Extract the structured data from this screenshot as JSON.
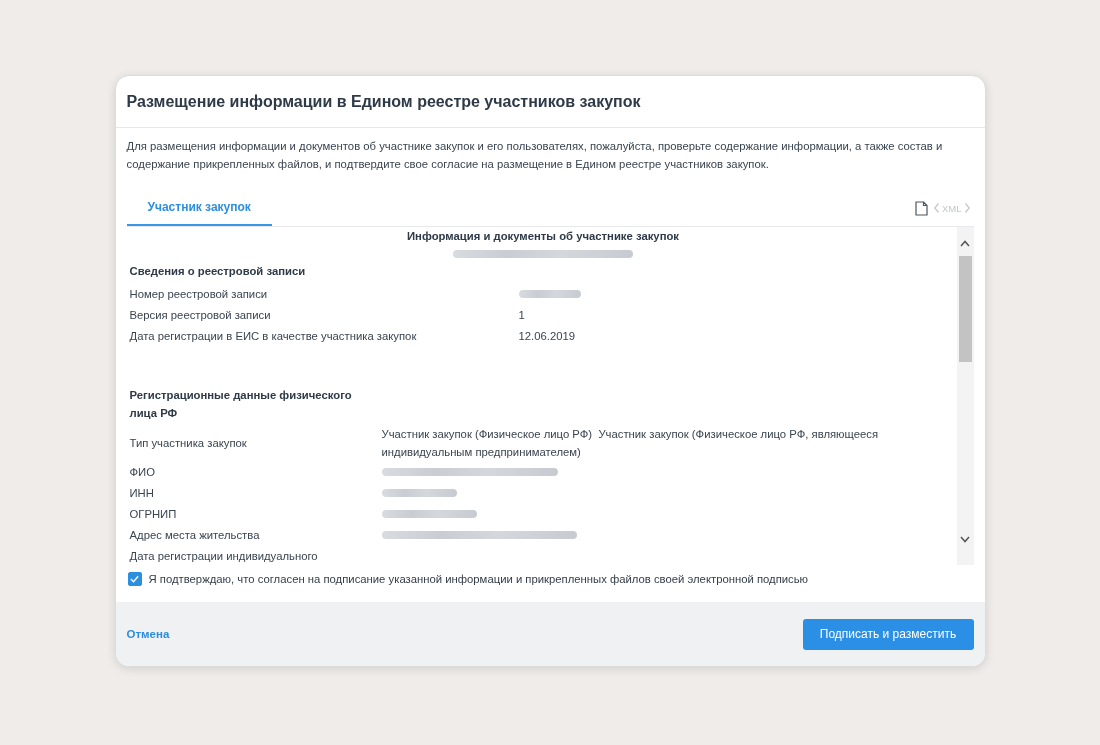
{
  "dialog": {
    "title": "Размещение информации в Едином реестре участников закупок"
  },
  "description": "Для размещения информации и документов об участнике закупок и его пользователях, пожалуйста, проверьте содержание информации, а также состав и содержание прикрепленных файлов, и подтвердите свое согласие на размещение в Едином реестре участников закупок.",
  "tabs": [
    {
      "label": "Участник закупок",
      "selected": true
    }
  ],
  "xml_link": {
    "label": "XML",
    "disabled": true
  },
  "document": {
    "heading": "Информация и документы об участнике закупок",
    "subheading_redacted": true,
    "sections": [
      {
        "title": "Сведения о реестровой записи",
        "rows": [
          {
            "label": "Номер реестровой записи",
            "redacted": true
          },
          {
            "label": "Версия реестровой записи",
            "value": "1",
            "redacted": false
          },
          {
            "label": "Дата регистрации в ЕИС в качестве участника закупок",
            "value": "12.06.2019",
            "redacted": false
          }
        ]
      },
      {
        "title": "Регистрационные данные физического лица РФ",
        "rows": [
          {
            "label": "Тип участника закупок",
            "value": "Участник закупок (Физическое лицо РФ)  Участник закупок (Физическое лицо РФ, являющееся индивидуальным предпринимателем)",
            "redacted": false
          },
          {
            "label": "ФИО",
            "redacted": true
          },
          {
            "label": "ИНН",
            "redacted": true
          },
          {
            "label": "ОГРНИП",
            "redacted": true
          },
          {
            "label": "Адрес места жительства",
            "redacted": true
          },
          {
            "label": "Дата регистрации индивидуального",
            "redacted": false
          }
        ]
      }
    ]
  },
  "agreement": {
    "label": "Я подтверждаю, что согласен на подписание указанной информации и прикрепленных файлов своей электронной подписью",
    "checked": true
  },
  "footer": {
    "cancel": "Отмена",
    "submit": "Подписать и разместить"
  }
}
